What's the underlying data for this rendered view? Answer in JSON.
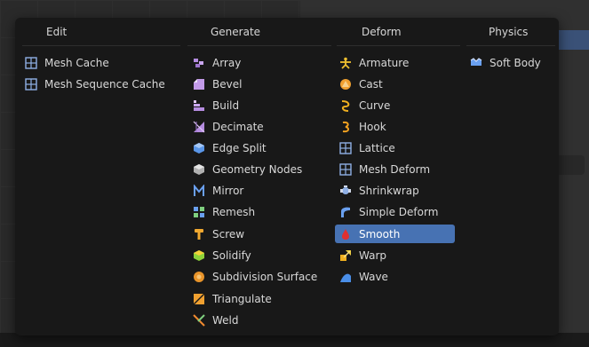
{
  "menu": {
    "columns": [
      {
        "header": "Edit",
        "items": [
          {
            "label": "Mesh Cache",
            "icon": "mesh-cache-icon"
          },
          {
            "label": "Mesh Sequence Cache",
            "icon": "mesh-sequence-cache-icon"
          }
        ]
      },
      {
        "header": "Generate",
        "items": [
          {
            "label": "Array",
            "icon": "array-icon"
          },
          {
            "label": "Bevel",
            "icon": "bevel-icon"
          },
          {
            "label": "Build",
            "icon": "build-icon"
          },
          {
            "label": "Decimate",
            "icon": "decimate-icon"
          },
          {
            "label": "Edge Split",
            "icon": "edge-split-icon"
          },
          {
            "label": "Geometry Nodes",
            "icon": "geometry-nodes-icon"
          },
          {
            "label": "Mirror",
            "icon": "mirror-icon"
          },
          {
            "label": "Remesh",
            "icon": "remesh-icon"
          },
          {
            "label": "Screw",
            "icon": "screw-icon"
          },
          {
            "label": "Solidify",
            "icon": "solidify-icon"
          },
          {
            "label": "Subdivision Surface",
            "icon": "subdivision-surface-icon"
          },
          {
            "label": "Triangulate",
            "icon": "triangulate-icon"
          },
          {
            "label": "Weld",
            "icon": "weld-icon"
          }
        ]
      },
      {
        "header": "Deform",
        "items": [
          {
            "label": "Armature",
            "icon": "armature-icon"
          },
          {
            "label": "Cast",
            "icon": "cast-icon"
          },
          {
            "label": "Curve",
            "icon": "curve-icon"
          },
          {
            "label": "Hook",
            "icon": "hook-icon"
          },
          {
            "label": "Lattice",
            "icon": "lattice-icon"
          },
          {
            "label": "Mesh Deform",
            "icon": "mesh-deform-icon"
          },
          {
            "label": "Shrinkwrap",
            "icon": "shrinkwrap-icon"
          },
          {
            "label": "Simple Deform",
            "icon": "simple-deform-icon"
          },
          {
            "label": "Smooth",
            "icon": "smooth-icon",
            "selected": true
          },
          {
            "label": "Warp",
            "icon": "warp-icon"
          },
          {
            "label": "Wave",
            "icon": "wave-icon"
          }
        ]
      },
      {
        "header": "Physics",
        "items": [
          {
            "label": "Soft Body",
            "icon": "soft-body-icon"
          }
        ]
      }
    ]
  },
  "colors": {
    "menu_bg": "#181818",
    "highlight": "#4772b3",
    "text": "#d8d8d8"
  }
}
